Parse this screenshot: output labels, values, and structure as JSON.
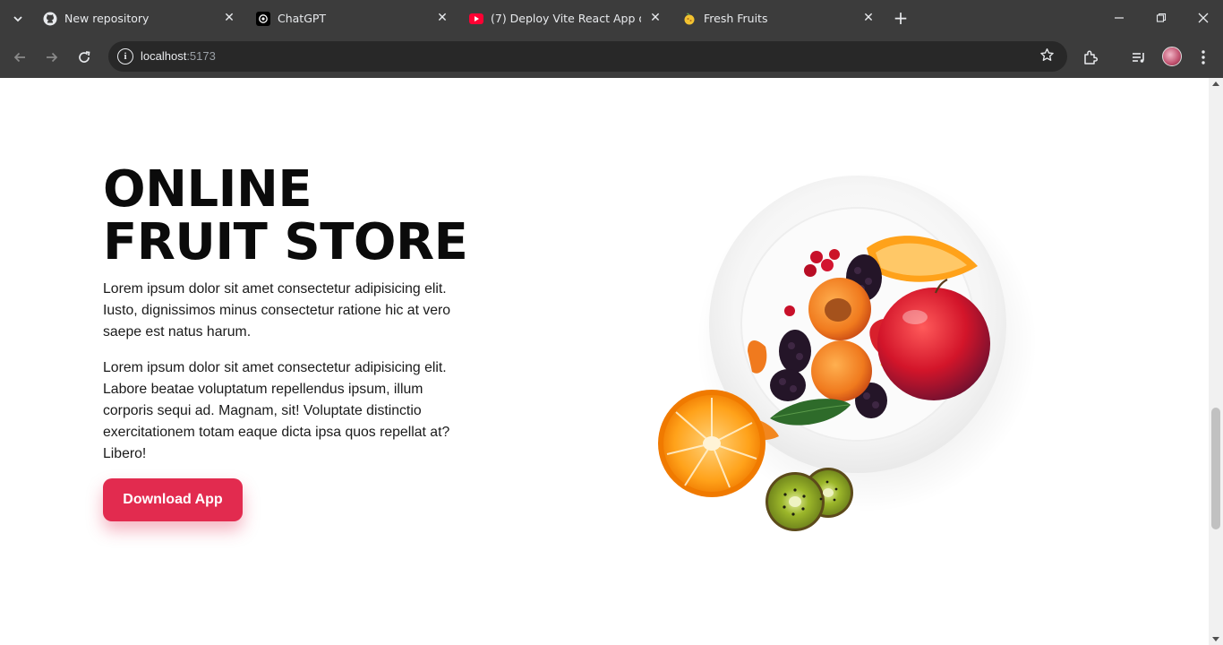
{
  "browser": {
    "tabs": [
      {
        "title": "New repository",
        "icon": "github-icon"
      },
      {
        "title": "ChatGPT",
        "icon": "chatgpt-icon"
      },
      {
        "title": "(7) Deploy Vite React App on Gi",
        "icon": "youtube-icon"
      },
      {
        "title": "Fresh Fruits",
        "icon": "fruit-favicon-icon"
      }
    ],
    "url_host": "localhost",
    "url_port": ":5173"
  },
  "hero": {
    "title_line1": "ONLINE",
    "title_line2": "FRUIT STORE",
    "paragraph1": "Lorem ipsum dolor sit amet consectetur adipisicing elit. Iusto, dignissimos minus consectetur ratione hic at vero saepe est natus harum.",
    "paragraph2": "Lorem ipsum dolor sit amet consectetur adipisicing elit. Labore beatae voluptatum repellendus ipsum, illum corporis sequi ad. Magnam, sit! Voluptate distinctio exercitationem totam eaque dicta ipsa quos repellat at? Libero!",
    "button_label": "Download App",
    "button_color": "#e22b4f"
  }
}
